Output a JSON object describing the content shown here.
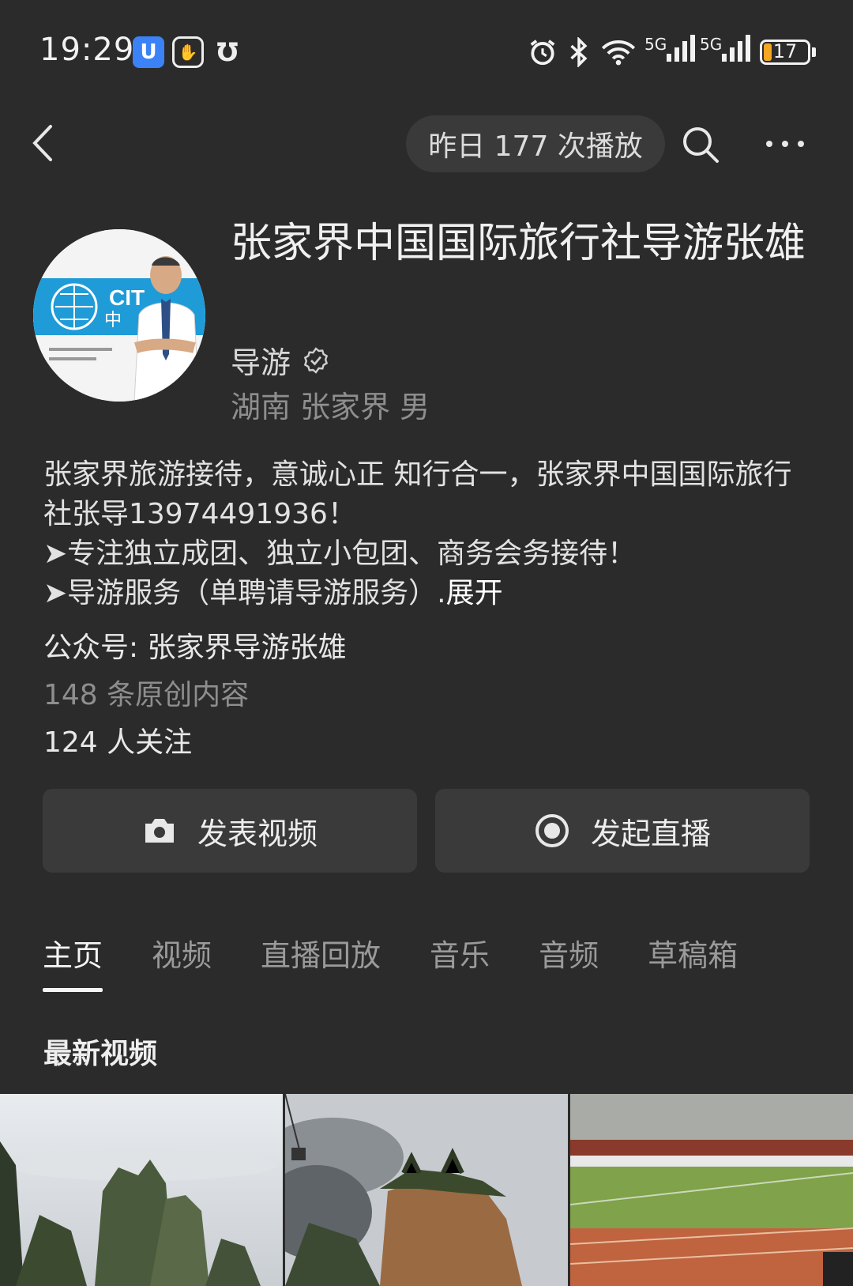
{
  "status_bar": {
    "time": "19:29",
    "app_icon_1": "u-app-icon",
    "app_icon_2": "hand-icon",
    "app_icon_3": "u-outline-icon",
    "network_1": "5G",
    "network_2": "5G",
    "battery": "17",
    "battery_level": 0.17,
    "battery_color": "#f5a623"
  },
  "nav": {
    "plays_label": "昨日 177 次播放"
  },
  "profile": {
    "name": "张家界中国国际旅行社导游张雄",
    "role": "导游",
    "location": "湖南 张家界 男",
    "bio_lines": [
      "张家界旅游接待，意诚心正 知行合一，张家界中国国际旅行社张导13974491936！",
      "➤专注独立成团、独立小包团、商务会务接待！",
      "➤导游服务（单聘请导游服务）."
    ],
    "expand_label": "展开",
    "gzh": "公众号: 张家界导游张雄",
    "original_count": "148 条原创内容",
    "followers": "124 人关注",
    "avatar_text": "CIT",
    "avatar_text_2": "中"
  },
  "buttons": {
    "post_video": "发表视频",
    "start_live": "发起直播"
  },
  "tabs": [
    {
      "label": "主页",
      "active": true
    },
    {
      "label": "视频",
      "active": false
    },
    {
      "label": "直播回放",
      "active": false
    },
    {
      "label": "音乐",
      "active": false
    },
    {
      "label": "音频",
      "active": false
    },
    {
      "label": "草稿箱",
      "active": false
    }
  ],
  "latest": {
    "title": "最新视频"
  },
  "colors": {
    "background": "#2b2b2b",
    "button_bg": "#3a3a3a",
    "avatar_banner": "#1f9bd7"
  }
}
